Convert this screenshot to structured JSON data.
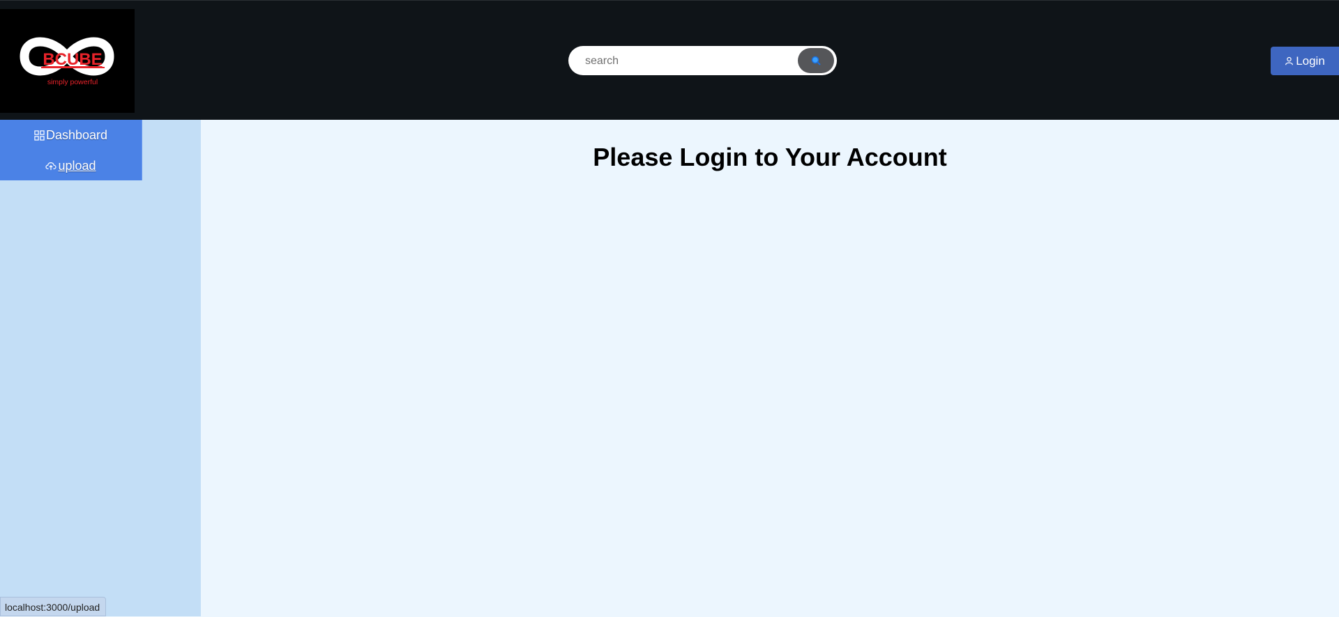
{
  "brand": {
    "logo_text": "BCUBE",
    "tagline": "simply powerful"
  },
  "search": {
    "placeholder": "search",
    "value": ""
  },
  "auth": {
    "login_label": "Login"
  },
  "sidebar": {
    "items": [
      {
        "label": "Dashboard",
        "icon": "dashboard-grid-icon"
      },
      {
        "label": "upload",
        "icon": "cloud-upload-icon"
      }
    ]
  },
  "main": {
    "title": "Please Login to Your Account"
  },
  "status": {
    "url": "localhost:3000/upload"
  },
  "colors": {
    "header_bg": "#0f1418",
    "sidebar_bg": "#c3def6",
    "nav_bg": "#4b82e6",
    "content_bg": "#ecf6fe",
    "login_button_bg": "#3e66c0",
    "brand_red": "#e8232a"
  }
}
